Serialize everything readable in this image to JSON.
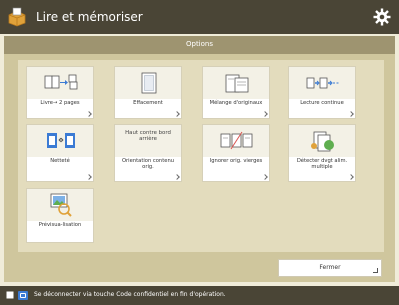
{
  "header": {
    "title": "Lire et mémoriser",
    "app_icon": "read-and-store-icon",
    "settings_icon": "gear-icon"
  },
  "section": {
    "title": "Options"
  },
  "options": [
    {
      "label": "Livre→ 2 pages",
      "icon": "book-to-two-pages-icon"
    },
    {
      "label": "Effacement",
      "icon": "erase-frame-icon"
    },
    {
      "label": "Mélange d'originaux",
      "icon": "mixed-originals-icon"
    },
    {
      "label": "Lecture continue",
      "icon": "job-build-icon"
    },
    {
      "label": "Netteté",
      "icon": "sharpness-icon"
    },
    {
      "label": "Orientation contenu orig.",
      "icon_text": "Haut contre bord arrière"
    },
    {
      "label": "Ignorer orig. vierges",
      "icon": "skip-blank-originals-icon"
    },
    {
      "label": "Détecter dvgt alim. multiple",
      "icon": "detect-multi-feed-icon"
    },
    {
      "label": "Prévisua-lisation",
      "icon": "preview-icon"
    }
  ],
  "close_button": {
    "label": "Fermer"
  },
  "footer": {
    "text": "Se déconnecter via touche Code confidentiel en fin d'opération."
  },
  "colors": {
    "header_bg": "#4a4536",
    "panel_bg": "#cfc69d",
    "section_bar": "#9e9470",
    "icon_blue": "#3b7bd4"
  }
}
